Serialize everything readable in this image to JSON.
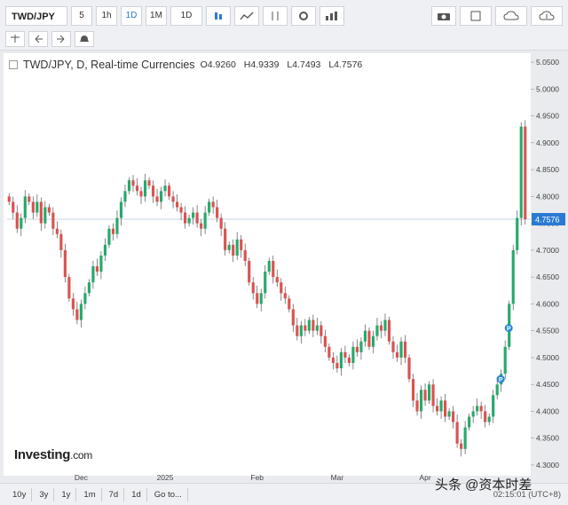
{
  "toolbar": {
    "symbol": "TWD/JPY",
    "intervals": [
      "5",
      "1h",
      "1D",
      "1M",
      "1D"
    ],
    "active_interval": "1D"
  },
  "header": {
    "title": "TWD/JPY, D, Real-time Currencies",
    "open_label": "O",
    "open": "4.9260",
    "high_label": "H",
    "high": "4.9339",
    "low_label": "L",
    "low": "4.7493",
    "close_label": "L",
    "close": "4.7576"
  },
  "range_buttons": [
    "10y",
    "3y",
    "1y",
    "1m",
    "7d",
    "1d",
    "Go to..."
  ],
  "clock": "02:15:01 (UTC+8)",
  "watermark": "头条 @资本时差",
  "logo": {
    "main": "Investing",
    "suffix": ".com"
  },
  "colors": {
    "up": "#26a96c",
    "down": "#d9534f",
    "price_tag": "#2a7ad3",
    "marker": "#2a8ad0"
  },
  "chart_data": {
    "type": "candlestick",
    "title": "TWD/JPY, D, Real-time Currencies",
    "ylim": [
      4.29,
      5.06
    ],
    "y_ticks": [
      "5.0500",
      "5.0000",
      "4.9500",
      "4.9000",
      "4.8500",
      "4.8000",
      "4.7500",
      "4.7000",
      "4.6500",
      "4.6000",
      "4.5500",
      "4.5000",
      "4.4500",
      "4.4000",
      "4.3500",
      "4.3000"
    ],
    "x_labels": [
      {
        "label": "Dec",
        "index": 18
      },
      {
        "label": "2025",
        "index": 39
      },
      {
        "label": "Feb",
        "index": 62
      },
      {
        "label": "Mar",
        "index": 82
      },
      {
        "label": "Apr",
        "index": 104
      }
    ],
    "last_price": "4.7576",
    "last_value": 4.7576,
    "markers": [
      {
        "label": "P",
        "index": 124,
        "value": 4.555
      },
      {
        "label": "P",
        "index": 122,
        "value": 4.46
      }
    ],
    "closes": [
      4.79,
      4.77,
      4.74,
      4.76,
      4.8,
      4.79,
      4.77,
      4.79,
      4.75,
      4.78,
      4.77,
      4.74,
      4.73,
      4.7,
      4.65,
      4.61,
      4.59,
      4.57,
      4.6,
      4.62,
      4.64,
      4.67,
      4.66,
      4.69,
      4.71,
      4.74,
      4.73,
      4.76,
      4.79,
      4.81,
      4.83,
      4.82,
      4.81,
      4.8,
      4.83,
      4.82,
      4.8,
      4.79,
      4.81,
      4.82,
      4.8,
      4.79,
      4.78,
      4.77,
      4.75,
      4.76,
      4.77,
      4.75,
      4.74,
      4.77,
      4.79,
      4.78,
      4.76,
      4.74,
      4.7,
      4.71,
      4.69,
      4.72,
      4.7,
      4.68,
      4.64,
      4.62,
      4.6,
      4.62,
      4.66,
      4.68,
      4.65,
      4.64,
      4.62,
      4.61,
      4.59,
      4.56,
      4.54,
      4.56,
      4.55,
      4.57,
      4.55,
      4.56,
      4.54,
      4.52,
      4.5,
      4.49,
      4.48,
      4.51,
      4.5,
      4.49,
      4.52,
      4.51,
      4.53,
      4.55,
      4.52,
      4.54,
      4.56,
      4.55,
      4.57,
      4.53,
      4.51,
      4.5,
      4.53,
      4.5,
      4.46,
      4.42,
      4.4,
      4.44,
      4.42,
      4.45,
      4.41,
      4.4,
      4.42,
      4.39,
      4.4,
      4.38,
      4.34,
      4.33,
      4.37,
      4.39,
      4.4,
      4.41,
      4.4,
      4.38,
      4.39,
      4.43,
      4.45,
      4.47,
      4.52,
      4.6,
      4.7,
      4.76,
      4.93,
      4.7576
    ]
  }
}
